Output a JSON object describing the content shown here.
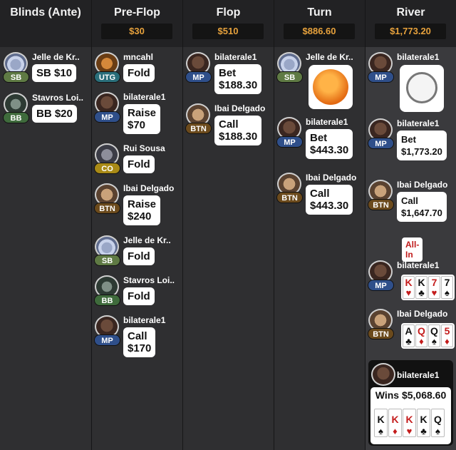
{
  "columns": [
    {
      "title": "Blinds (Ante)",
      "pot": ""
    },
    {
      "title": "Pre-Flop",
      "pot": "$30"
    },
    {
      "title": "Flop",
      "pot": "$510"
    },
    {
      "title": "Turn",
      "pot": "$886.60"
    },
    {
      "title": "River",
      "pot": "$1,773.20"
    }
  ],
  "blinds": [
    {
      "name": "Jelle de Kr..",
      "pos": "SB",
      "action": "SB $10",
      "avatar": "fish-avatar"
    },
    {
      "name": "Stavros Loi..",
      "pos": "BB",
      "action": "BB $20",
      "avatar": "alien-avatar"
    }
  ],
  "preflop": [
    {
      "name": "mncahl",
      "pos": "UTG",
      "action": "Fold",
      "avatar": "owl-avatar"
    },
    {
      "name": "bilaterale1",
      "pos": "MP",
      "action": "Raise\n$70",
      "avatar": "gorilla-avatar"
    },
    {
      "name": "Rui Sousa",
      "pos": "CO",
      "action": "Fold",
      "avatar": "robot-avatar"
    },
    {
      "name": "Ibai Delgado",
      "pos": "BTN",
      "action": "Raise\n$240",
      "avatar": "man-sunglasses-avatar"
    },
    {
      "name": "Jelle de Kr..",
      "pos": "SB",
      "action": "Fold",
      "avatar": "fish-avatar"
    },
    {
      "name": "Stavros Loi..",
      "pos": "BB",
      "action": "Fold",
      "avatar": "alien-avatar"
    },
    {
      "name": "bilaterale1",
      "pos": "MP",
      "action": "Call\n$170",
      "avatar": "gorilla-avatar"
    }
  ],
  "flop": [
    {
      "name": "bilaterale1",
      "pos": "MP",
      "action": "Bet\n$188.30",
      "avatar": "gorilla-avatar"
    },
    {
      "name": "Ibai Delgado",
      "pos": "BTN",
      "action": "Call\n$188.30",
      "avatar": "man-sunglasses-avatar"
    }
  ],
  "turn": [
    {
      "name": "Jelle de Kr..",
      "pos": "SB",
      "action": "",
      "avatar": "fish-avatar",
      "emote": "crying-face-emote"
    },
    {
      "name": "bilaterale1",
      "pos": "MP",
      "action": "Bet\n$443.30",
      "avatar": "gorilla-avatar"
    },
    {
      "name": "Ibai Delgado",
      "pos": "BTN",
      "action": "Call\n$443.30",
      "avatar": "man-sunglasses-avatar"
    }
  ],
  "river": [
    {
      "name": "bilaterale1",
      "pos": "MP",
      "action": "",
      "avatar": "gorilla-avatar",
      "emote": "alarm-clock-emote"
    },
    {
      "name": "bilaterale1",
      "pos": "MP",
      "action": "Bet\n$1,773.20",
      "avatar": "gorilla-avatar"
    },
    {
      "name": "Ibai Delgado",
      "pos": "BTN",
      "action": "Call\n$1,647.70",
      "avatar": "man-sunglasses-avatar",
      "badge": "All-In"
    }
  ],
  "showdown": [
    {
      "name": "bilaterale1",
      "pos": "MP",
      "cards": [
        {
          "r": "K",
          "s": "♥",
          "c": "red"
        },
        {
          "r": "K",
          "s": "♣",
          "c": "blk"
        },
        {
          "r": "7",
          "s": "♥",
          "c": "red"
        },
        {
          "r": "7",
          "s": "♠",
          "c": "blk"
        }
      ]
    },
    {
      "name": "Ibai Delgado",
      "pos": "BTN",
      "cards": [
        {
          "r": "A",
          "s": "♣",
          "c": "blk"
        },
        {
          "r": "Q",
          "s": "♦",
          "c": "red"
        },
        {
          "r": "Q",
          "s": "♠",
          "c": "blk"
        },
        {
          "r": "5",
          "s": "♦",
          "c": "red"
        }
      ]
    }
  ],
  "winner": {
    "name": "bilaterale1",
    "label": "Wins $5,068.60",
    "cards": [
      {
        "r": "K",
        "s": "♠",
        "c": "blk"
      },
      {
        "r": "K",
        "s": "♦",
        "c": "red"
      },
      {
        "r": "K",
        "s": "♥",
        "c": "red"
      },
      {
        "r": "K",
        "s": "♣",
        "c": "blk"
      },
      {
        "r": "Q",
        "s": "♠",
        "c": "blk"
      }
    ]
  },
  "colors": {
    "pot_text": "#e6a13c",
    "allin_text": "#c01b1b"
  }
}
